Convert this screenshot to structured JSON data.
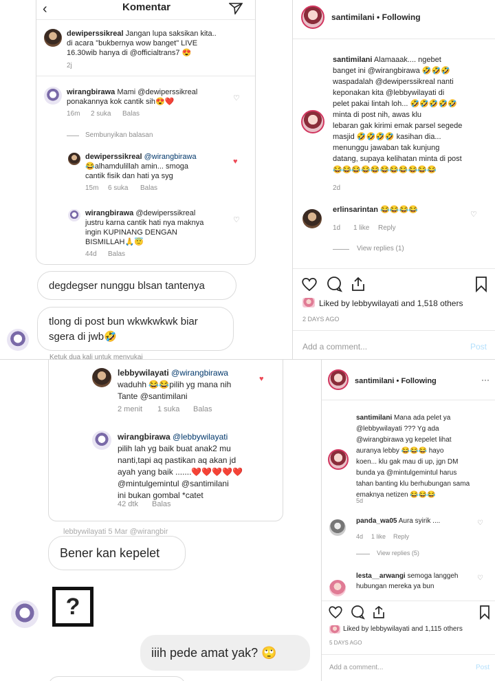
{
  "top_left": {
    "header_title": "Komentar",
    "caption": {
      "user": "dewiperssikreal",
      "lines": [
        "Jangan lupa saksikan kita..",
        "di acara \"bukbernya wow banget\" LIVE",
        "16.30wib hanya di @officialtrans7 😍"
      ],
      "time": "2j"
    },
    "comment1": {
      "user": "wirangbirawa",
      "lines": [
        "Mami @dewiperssikreal",
        "ponakannya kok cantik sih😍❤️"
      ],
      "time": "16m",
      "likes": "2 suka",
      "reply": "Balas"
    },
    "hide_replies": "Sembunyikan balasan",
    "reply1": {
      "user": "dewiperssikreal",
      "lines": [
        "@wirangbirawa",
        "😂alhamdulillah amin... smoga",
        "cantik fisik dan hati ya syg"
      ],
      "time": "15m",
      "likes": "6 suka",
      "reply": "Balas"
    },
    "reply2": {
      "user": "wirangbirawa",
      "lines": [
        "@dewiperssikreal",
        "justru karna cantik hati nya maknya",
        "ingin KUPINANG DENGAN",
        "BISMILLAH🙏😇"
      ],
      "time": "44d",
      "reply": "Balas"
    },
    "bubble1": "degdegser nunggu blsan tantenya",
    "bubble2_lines": [
      "tlong di post bun wkwkwkwk biar",
      "sgera di jwb🤣"
    ],
    "cut_text": "Ketuk dua kali untuk menyukai"
  },
  "top_right": {
    "user": "santimilani",
    "following": "• Following",
    "caption_user": "santimilani",
    "caption_lines": [
      "Alamaaak.... ngebet",
      "banget ini @wirangbirawa 🤣🤣🤣",
      "waspadalah @dewiperssikreal nanti",
      "keponakan kita @lebbywilayati di",
      "pelet pakai lintah loh... 🤣🤣🤣🤣🤣",
      "minta di post nih, awas klu",
      "lebaran gak kirimi emak parsel segede",
      "masjid 🤣🤣🤣🤣 kasihan dia...",
      "menunggu jawaban tak kunjung",
      "datang, supaya kelihatan minta di post",
      "😂😂😂😂😂😂😂😂😂😂😂"
    ],
    "caption_time": "2d",
    "comment_user": "erlinsarintan",
    "comment_text": "😂😂😂😂",
    "comment_likes": "1 like",
    "comment_reply": "Reply",
    "view_replies": "View replies (1)",
    "liked_by": "Liked by lebbywilayati and 1,518 others",
    "date": "2 DAYS AGO",
    "add_comment": "Add a comment...",
    "post": "Post"
  },
  "bottom_left": {
    "reply1": {
      "user": "lebbywilayati",
      "lines": [
        "@wirangbirawa",
        "waduhh 😂😂pilih yg mana nih",
        "Tante @santimilani"
      ],
      "time": "2 menit",
      "likes": "1 suka",
      "reply": "Balas"
    },
    "reply2": {
      "user": "wirangbirawa",
      "lines": [
        "@lebbywilayati",
        "pilih lah yg baik buat anak2 mu",
        "nanti,tapi aq pastikan aq akan jd",
        "ayah yang baik .......❤️❤️❤️❤️❤️",
        "@mintulgemintul @santimilani",
        "ini bukan gombal *catet"
      ],
      "time": "42 dtk",
      "reply": "Balas"
    },
    "cut_text": "lebbywilayati 5 Mar @wirangbir",
    "bubble1": "Bener kan kepelet",
    "bubble2": "iiih pede amat yak? 🙄"
  },
  "bottom_right": {
    "user": "santimilani",
    "following": "• Following",
    "caption_user": "santimilani",
    "caption_lines": [
      "Mana ada pelet ya",
      "@lebbywilayati ??? Yg ada",
      "@wirangbirawa yg kepelet lihat",
      "auranya lebby 😂😂😂 hayo",
      "koen... klu gak mau di up, jgn DM",
      "bunda ya @mintulgemintul harus",
      "tahan banting klu berhubungan sama",
      "emaknya netizen 😂😂😂"
    ],
    "caption_time": "5d",
    "c1_user": "panda_wa05",
    "c1_text": "Aura syirik ....",
    "c1_time": "4d",
    "c1_likes": "1 like",
    "c1_reply": "Reply",
    "view_replies": "View replies (5)",
    "c2_user": "lesta__arwangi",
    "c2_lines": [
      "semoga langgeh",
      "hubungan mereka ya bun"
    ],
    "liked_by": "Liked by lebbywilayati and 1,115 others",
    "date": "5 DAYS AGO",
    "add_comment": "Add a comment...",
    "post": "Post"
  }
}
